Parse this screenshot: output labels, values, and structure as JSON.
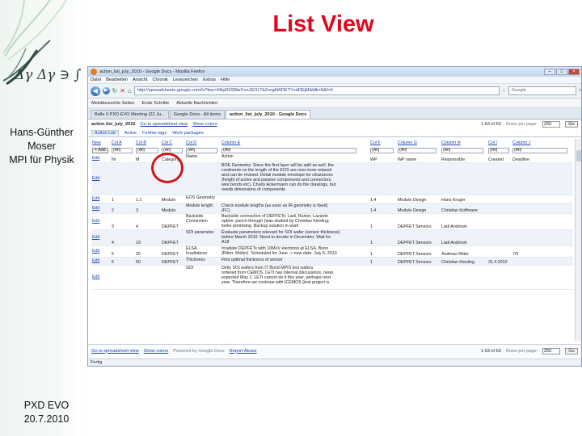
{
  "slide": {
    "title": "List View",
    "author_lines": [
      "Hans-Günther",
      "Moser",
      "MPI für Physik"
    ],
    "footer_lines": [
      "PXD EVO",
      "20.7.2010"
    ],
    "accent_color": "#e1061b"
  },
  "browser": {
    "window_title": "action_list_july_2010 - Google Docs - Mozilla Firefox",
    "menu": [
      "Datei",
      "Bearbeiten",
      "Ansicht",
      "Chronik",
      "Lesezeichen",
      "Extras",
      "Hilfe"
    ],
    "url": "http://spreadsheets.google.com/lv?key=0ApD5SBbrFunJEOLTb2nrg&WDETYxdDEjM&fdk=5&f=0",
    "search_placeholder": "Google",
    "bookmarks": [
      "Meistbesuchte Seiten",
      "Erste Schritte",
      "Aktuelle Nachrichten"
    ],
    "tabs": [
      {
        "label": "Belle II PXD EVO Meeting (22 Ju...",
        "active": false
      },
      {
        "label": "Google Docs - All items",
        "active": false
      },
      {
        "label": "action_list_july_2010 - Google Docs",
        "active": true
      }
    ],
    "status": "Fertig"
  },
  "list": {
    "title": "action list_july_2010",
    "links": [
      "Go to spreadsheet view",
      "Show colors"
    ],
    "range": "1-63 of 63",
    "rows_per_page_label": "Rows per page:",
    "rows_per_page_value": "250",
    "go_label": "Go",
    "view_tabs": [
      "Action List",
      "Active",
      "Further tags",
      "Work packages"
    ],
    "add_label": "Add",
    "columns": [
      "New",
      "Col A",
      "Col B",
      "Col C",
      "Col D",
      "Column E",
      "Col F",
      "Column G",
      "Column H",
      "Col I",
      "Column J"
    ],
    "filters": [
      "",
      "(All)",
      "(All)",
      "(All)",
      "(All)",
      "(All)",
      "(All)",
      "(All)",
      "(All)",
      "(All)",
      "(All)"
    ],
    "rows": [
      {
        "edit": "Edit",
        "a": "Nr",
        "b": "M",
        "c": "Category",
        "d": "Name",
        "e": "Action",
        "f": "WP",
        "g": "WP name",
        "h": "Responsible",
        "i": "Created",
        "j": "Deadline"
      },
      {
        "edit": "Edit",
        "a": "",
        "b": "",
        "c": "",
        "d": "",
        "e": "BOE Geometry: Since the first layer will be split as well, the\ncontinents on the length of the EOS are now more relaxed\nand can be revised. Detail module envelope for clearances\n(height of active and passive components and connectors,\nwire bonds etc). Charly Ackermann can do the drawings, but\nneeds dimensions of components",
        "f": "",
        "g": "",
        "h": "",
        "i": "",
        "j": ""
      },
      {
        "edit": "Edit",
        "a": "1",
        "b": "1.1",
        "c": "Module",
        "d": "EOS Geometry",
        "e": "",
        "f": "1.4",
        "g": "Module Design",
        "h": "Hans Kruger",
        "i": "",
        "j": ""
      },
      {
        "edit": "Edit",
        "a": "2",
        "b": "3",
        "c": "Module",
        "d": "Module length",
        "e": "Check module lengths (as soon as IR geometry is fixed)\n(FC)",
        "f": "1.4",
        "g": "Module Design",
        "h": "Christian Koffmane",
        "i": "",
        "j": ""
      },
      {
        "edit": "Edit",
        "a": "3",
        "b": "4",
        "c": "DEPFET",
        "d": "Backside\nConnection",
        "e": "Backside connection of DEPFETs: Ladi, Rainer, Lavante\noption: punch through (was studied by Christian Kiesling;\nlooks promising. Backup solution in work",
        "f": "1",
        "g": "DEPFET Sensors",
        "h": "Ladi Andricek",
        "i": "",
        "j": ""
      },
      {
        "edit": "Edit",
        "a": "4",
        "b": "19",
        "c": "DEPFET",
        "d": "SOI parameter",
        "e": "Evaluate parameters relevant for SOI wafer (sensor thickness)\nbefore March 2010. Need to decide in December. Wait for\nA18",
        "f": "1",
        "g": "DEPFET Sensors",
        "h": "Ladi Andricek",
        "i": "",
        "j": ""
      },
      {
        "edit": "Edit",
        "a": "5",
        "b": "20",
        "c": "DEPFET",
        "d": "ELSA\nIrradiations",
        "e": "Irradiate DEPFETs with 10MeV electrons at ELSA, Bonn\n(Ritter, Müller). Scheduled for June -> new date: July 5, 2010",
        "f": "1",
        "g": "DEPFET Sensors",
        "h": "Andreas Ritter",
        "i": "",
        "j": "7/5"
      },
      {
        "edit": "Edit",
        "a": "6",
        "b": "50",
        "c": "DEPFET",
        "d": "Thickness",
        "e": "Find optimal thickness of sensor",
        "f": "1",
        "g": "DEPFET Sensors",
        "h": "Christian Kiesling",
        "i": "31.4.2010",
        "j": ""
      },
      {
        "edit": "Edit",
        "a": "",
        "b": "",
        "c": "",
        "d": "SOI",
        "e": "Dirtly SOI wafers from IT Bond MPIS test wafers\nordered from CEMOS. LETI has internal discussions, news\nexpected May 1. LETI cannot do it this year, perhaps next\nyear. Therefore we continue with ICEMOS (test project is",
        "f": "",
        "g": "",
        "h": "",
        "i": "",
        "j": ""
      }
    ],
    "powered_by": "Powered by Google Docs",
    "report_abuse": "Report Abuse"
  }
}
